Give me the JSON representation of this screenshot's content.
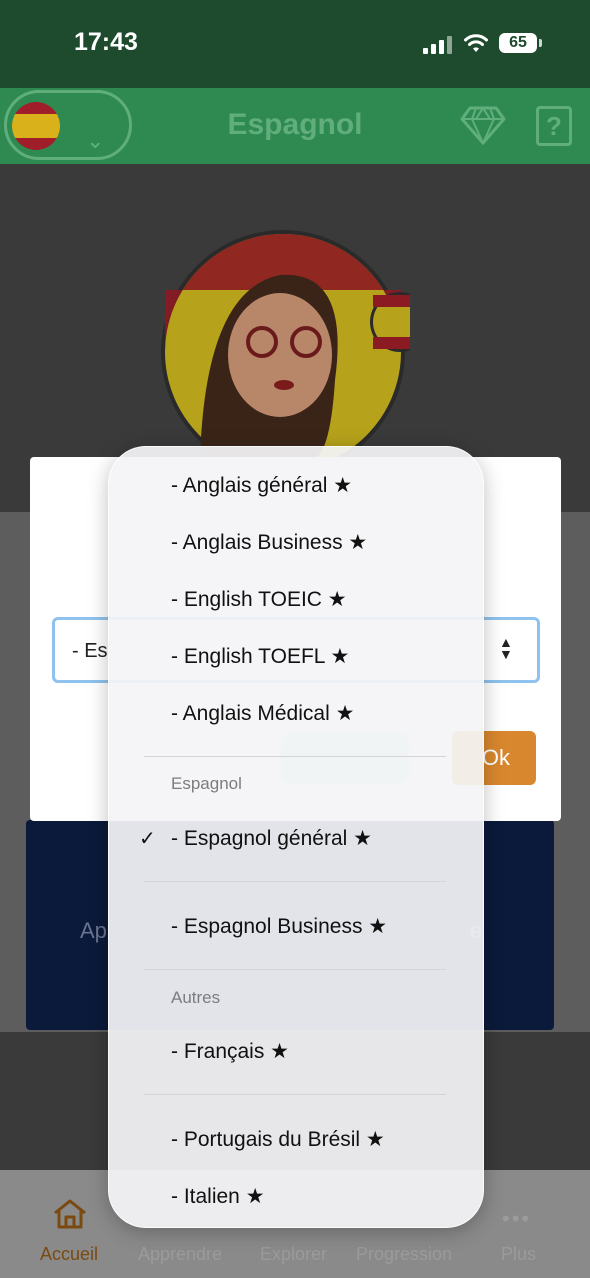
{
  "status_bar": {
    "time": "17:43",
    "battery": "65"
  },
  "header": {
    "title": "Espagnol"
  },
  "modal": {
    "select_value": "- Es",
    "ok_label": "Ok"
  },
  "background": {
    "left_text": "Ap",
    "right_text": "e"
  },
  "tab_bar": {
    "items": [
      {
        "label": "Accueil",
        "icon": "home-icon",
        "active": true
      },
      {
        "label": "Apprendre",
        "icon": "learn-icon",
        "active": false
      },
      {
        "label": "Explorer",
        "icon": "search-icon",
        "active": false
      },
      {
        "label": "Progression",
        "icon": "progress-icon",
        "active": false
      },
      {
        "label": "Plus",
        "icon": "more-icon",
        "active": false
      }
    ]
  },
  "dropdown": {
    "items": [
      {
        "label": "- Anglais général ★"
      },
      {
        "label": "- Anglais Business ★"
      },
      {
        "label": "- English TOEIC ★"
      },
      {
        "label": "- English TOEFL ★"
      },
      {
        "label": "- Anglais Médical ★"
      },
      {
        "section": "Espagnol"
      },
      {
        "label": "- Espagnol général ★",
        "selected": true
      },
      {
        "label": "- Espagnol Business ★"
      },
      {
        "section": "Autres"
      },
      {
        "label": "- Français ★"
      },
      {
        "label": "- Portugais du Brésil ★"
      },
      {
        "label": "- Italien ★"
      }
    ],
    "check_mark": "✓"
  },
  "colors": {
    "status_bar": "#1e4a2d",
    "header": "#2f8a52",
    "accent_green": "#5fae7c",
    "ok_button": "#d8872e",
    "select_border": "#8fc2ee"
  }
}
